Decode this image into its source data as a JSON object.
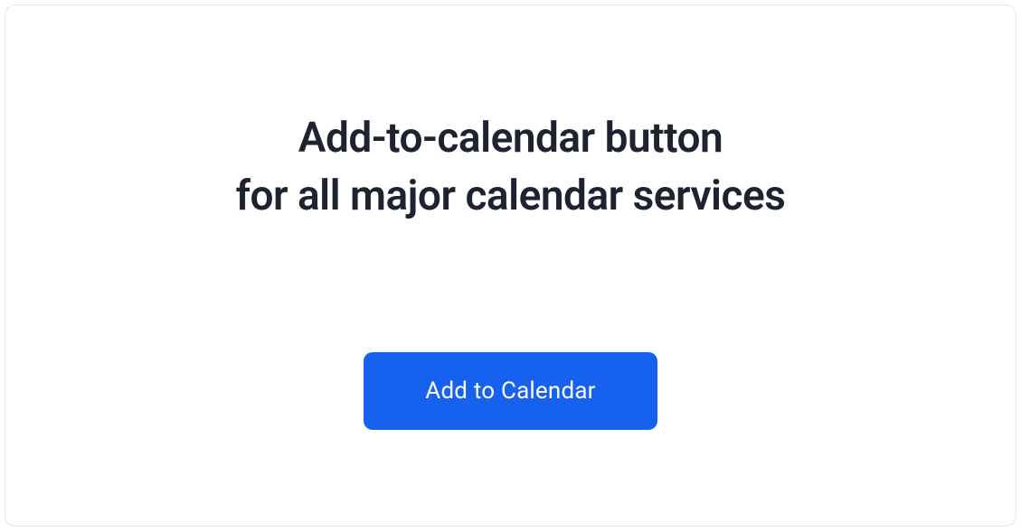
{
  "heading": {
    "line1": "Add-to-calendar button",
    "line2": "for all major calendar services"
  },
  "button": {
    "label": "Add to Calendar"
  }
}
